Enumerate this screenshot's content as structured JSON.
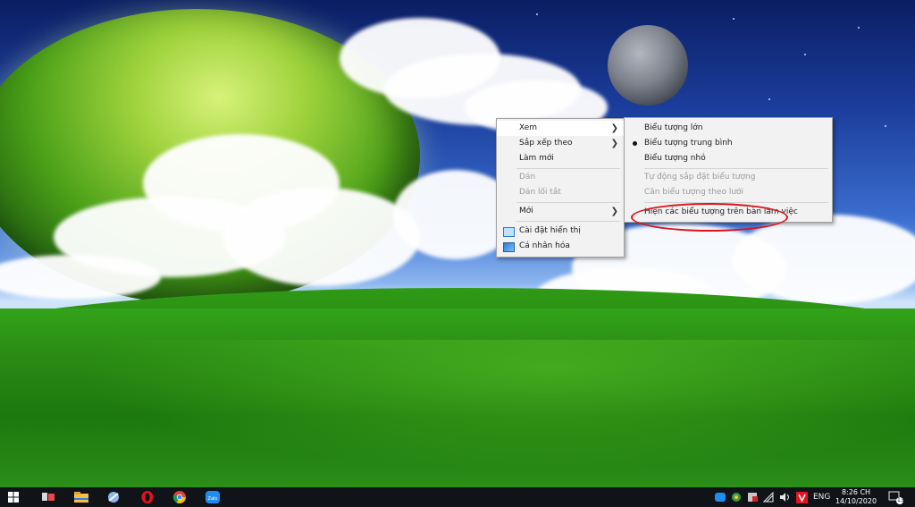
{
  "context_menu": {
    "items": [
      {
        "label": "Xem",
        "has_submenu": true,
        "highlighted": true
      },
      {
        "label": "Sắp xếp theo",
        "has_submenu": true
      },
      {
        "label": "Làm mới"
      },
      {
        "label": "Dán",
        "disabled": true
      },
      {
        "label": "Dán lối tắt",
        "disabled": true
      },
      {
        "label": "Mới",
        "has_submenu": true
      },
      {
        "label": "Cài đặt hiển thị",
        "icon": "display-settings-icon"
      },
      {
        "label": "Cá nhân hóa",
        "icon": "personalize-icon"
      }
    ]
  },
  "view_submenu": {
    "items": [
      {
        "label": "Biểu tượng lớn"
      },
      {
        "label": "Biểu tượng trung bình",
        "selected": true
      },
      {
        "label": "Biểu tượng nhỏ"
      },
      {
        "label": "Tự động sắp đặt biểu tượng",
        "disabled": true
      },
      {
        "label": "Căn biểu tượng theo lưới",
        "disabled": true
      },
      {
        "label": "Hiện các biểu tượng trên bàn làm việc",
        "annotated": true
      }
    ]
  },
  "annotation": {
    "color": "#d8141b",
    "shape": "ellipse"
  },
  "taskbar": {
    "pinned": [
      {
        "name": "start-icon"
      },
      {
        "name": "task-view-icon"
      },
      {
        "name": "file-explorer-icon"
      },
      {
        "name": "app-icon"
      },
      {
        "name": "opera-icon"
      },
      {
        "name": "chrome-icon"
      },
      {
        "name": "zalo-icon",
        "label": "Zalo"
      }
    ],
    "tray": {
      "language": "ENG",
      "time": "8:26 CH",
      "date": "14/10/2020",
      "notification_count": "13"
    }
  }
}
